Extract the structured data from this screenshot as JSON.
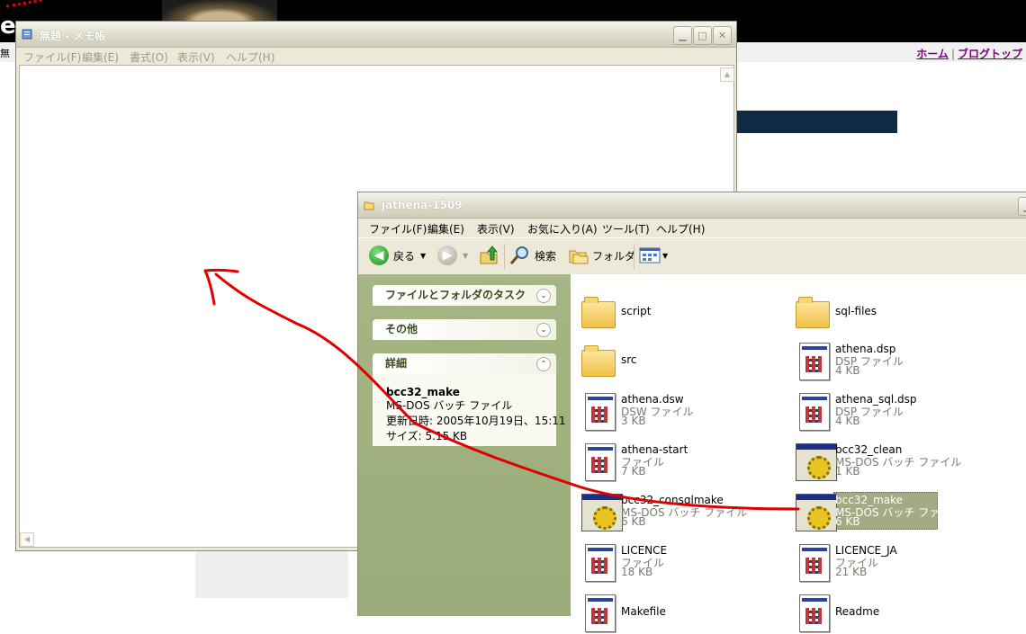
{
  "background_page": {
    "logo": "e",
    "left_fragment": "無",
    "links": [
      "ホーム",
      "ブログトップ"
    ],
    "link_separator": "|"
  },
  "notepad": {
    "title": "無題 - メモ帳",
    "menu": [
      "ファイル(F)",
      "編集(E)",
      "書式(O)",
      "表示(V)",
      "ヘルプ(H)"
    ],
    "content": ""
  },
  "explorer": {
    "title": "jathena-1509",
    "menu": [
      "ファイル(F)",
      "編集(E)",
      "表示(V)",
      "お気に入り(A)",
      "ツール(T)",
      "ヘルプ(H)"
    ],
    "toolbar": {
      "back": "戻る",
      "search": "検索",
      "folders": "フォルダ"
    },
    "panels": [
      {
        "title": "ファイルとフォルダのタスク",
        "chevron": "⌄"
      },
      {
        "title": "その他",
        "chevron": "⌄"
      },
      {
        "title": "詳細",
        "chevron": "⌃"
      }
    ],
    "details": {
      "name": "bcc32_make",
      "type": "MS-DOS バッチ ファイル",
      "modified": "更新日時: 2005年10月19日、15:11",
      "size": "サイズ: 5.15 KB"
    },
    "files": [
      {
        "name": "script",
        "type": "",
        "size": "",
        "icon": "folder-icon"
      },
      {
        "name": "sql-files",
        "type": "",
        "size": "",
        "icon": "folder-icon"
      },
      {
        "name": "src",
        "type": "",
        "size": "",
        "icon": "folder-icon"
      },
      {
        "name": "athena.dsp",
        "type": "DSP ファイル",
        "size": "4 KB",
        "icon": "document-icon"
      },
      {
        "name": "athena.dsw",
        "type": "DSW ファイル",
        "size": "3 KB",
        "icon": "document-icon"
      },
      {
        "name": "athena_sql.dsp",
        "type": "DSP ファイル",
        "size": "4 KB",
        "icon": "document-icon"
      },
      {
        "name": "athena-start",
        "type": "ファイル",
        "size": "7 KB",
        "icon": "document-icon"
      },
      {
        "name": "bcc32_clean",
        "type": "MS-DOS バッチ ファイル",
        "size": "1 KB",
        "icon": "batch-file-icon"
      },
      {
        "name": "bcc32_consqlmake",
        "type": "MS-DOS バッチ ファイル",
        "size": "6 KB",
        "icon": "batch-file-icon"
      },
      {
        "name": "bcc32_make",
        "type": "MS-DOS バッチ ファイル",
        "size": "6 KB",
        "icon": "batch-file-icon",
        "selected": true
      },
      {
        "name": "LICENCE",
        "type": "ファイル",
        "size": "18 KB",
        "icon": "document-icon"
      },
      {
        "name": "LICENCE_JA",
        "type": "ファイル",
        "size": "21 KB",
        "icon": "document-icon"
      },
      {
        "name": "Makefile",
        "type": "",
        "size": "",
        "icon": "document-icon"
      },
      {
        "name": "Readme",
        "type": "",
        "size": "",
        "icon": "document-icon"
      }
    ]
  },
  "annotation": {
    "color": "#e00000"
  }
}
